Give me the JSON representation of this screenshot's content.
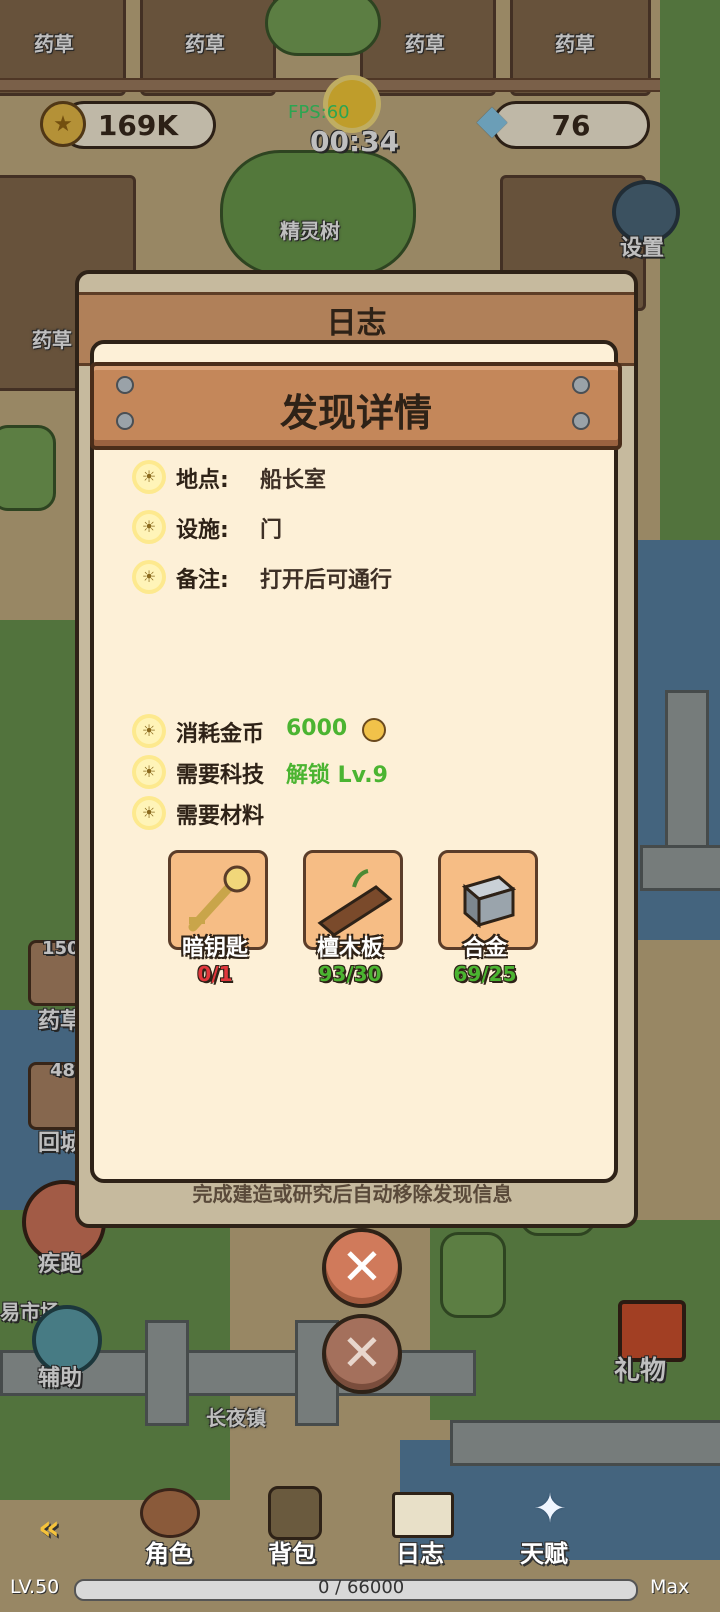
{
  "hud": {
    "gold": "169K",
    "gems": "76",
    "timer": "00:34",
    "fps": "FPS:60",
    "settings_label": "设置"
  },
  "world": {
    "herb_label": "药草",
    "tree_label": "精灵树",
    "town_label": "长夜镇",
    "left_count_1": "150",
    "left_count_2": "48",
    "left_label_1": "药草",
    "left_label_2": "回城",
    "run_label": "疾跑",
    "assist_label": "辅助",
    "market_label": "易市场",
    "gift_label": "礼物"
  },
  "back_panel": {
    "title": "日志"
  },
  "dialog": {
    "title": "发现详情",
    "location_label": "地点:",
    "location_value": "船长室",
    "facility_label": "设施:",
    "facility_value": "门",
    "note_label": "备注:",
    "note_value": "打开后可通行",
    "cost_label": "消耗金币",
    "cost_value": "6000",
    "tech_label": "需要科技",
    "tech_value": "解锁 Lv.9",
    "materials_label": "需要材料",
    "materials": [
      {
        "name": "暗钥匙",
        "count": "0/1",
        "icon": "key-icon",
        "sufficient": false
      },
      {
        "name": "檀木板",
        "count": "93/30",
        "icon": "wood-plank-icon",
        "sufficient": true
      },
      {
        "name": "合金",
        "count": "69/25",
        "icon": "alloy-cube-icon",
        "sufficient": true
      }
    ],
    "footnote": "完成建造或研究后自动移除发现信息"
  },
  "bottom_nav": {
    "items": [
      "角色",
      "背包",
      "日志",
      "天赋"
    ]
  },
  "level_bar": {
    "level": "LV.50",
    "progress_text": "0 / 66000",
    "max_label": "Max",
    "progress_fraction": 0
  },
  "colors": {
    "panel_bg": "#fdf0d7",
    "header_wood": "#c4875a",
    "sufficient_green": "#4bb431",
    "insufficient_red": "#e1373c"
  }
}
